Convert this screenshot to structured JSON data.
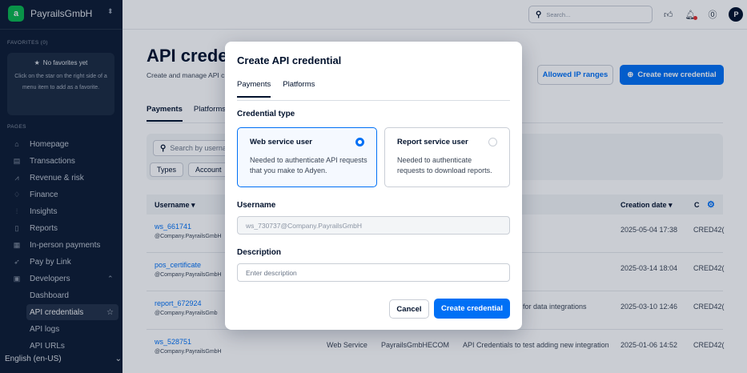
{
  "sidebar": {
    "brand": {
      "logo": "a",
      "name": "PayrailsGmbH"
    },
    "favorites_label": "FAVORITES (0)",
    "favorites": {
      "title": "No favorites yet",
      "text": "Click on the star on the right side of a menu item to add as a favorite."
    },
    "pages_label": "PAGES",
    "items": [
      {
        "label": "Homepage",
        "icon": "home-icon",
        "glyph": "⌂"
      },
      {
        "label": "Transactions",
        "icon": "transactions-icon",
        "glyph": "▤"
      },
      {
        "label": "Revenue & risk",
        "icon": "revenue-icon",
        "glyph": "⩘"
      },
      {
        "label": "Finance",
        "icon": "finance-icon",
        "glyph": "♢"
      },
      {
        "label": "Insights",
        "icon": "insights-icon",
        "glyph": "⫶"
      },
      {
        "label": "Reports",
        "icon": "reports-icon",
        "glyph": "▯"
      },
      {
        "label": "In-person payments",
        "icon": "terminal-icon",
        "glyph": "▦"
      },
      {
        "label": "Pay by Link",
        "icon": "link-icon",
        "glyph": "➶"
      },
      {
        "label": "Developers",
        "icon": "developers-icon",
        "glyph": "▣"
      }
    ],
    "sub_items": [
      "Dashboard",
      "API credentials",
      "API logs",
      "API URLs"
    ],
    "language": "English (en-US)"
  },
  "topbar": {
    "search_placeholder": "Search..."
  },
  "page": {
    "title": "API crede",
    "subtitle": "Create and manage API c",
    "allowed_ip_button": "Allowed IP ranges",
    "create_button": "Create new credential",
    "tabs": [
      "Payments",
      "Platforms"
    ],
    "search_placeholder": "Search by userna",
    "chips": [
      "Types",
      "Account"
    ],
    "columns": {
      "username": "Username",
      "creation_date": "Creation date",
      "id": "C"
    },
    "rows": [
      {
        "username": "ws_661741",
        "company": "@Company.PayrailsGmbH",
        "type": "",
        "account": "",
        "description": "",
        "date": "2025-05-04 17:38",
        "id": "CRED42("
      },
      {
        "username": "pos_certificate",
        "company": "@Company.PayrailsGmbH",
        "type": "",
        "account": "",
        "description": "",
        "date": "2025-03-14 18:04",
        "id": "CRED42("
      },
      {
        "username": "report_672924",
        "company": "@Company.PayrailsGmb",
        "type": "",
        "account": "",
        "description": "t for data integrations",
        "date": "2025-03-10 12:46",
        "id": "CRED42("
      },
      {
        "username": "ws_528751",
        "company": "@Company.PayrailsGmbH",
        "type": "Web Service",
        "account": "PayrailsGmbHECOM",
        "description": "API Credentials to test adding new integration",
        "date": "2025-01-06 14:52",
        "id": "CRED42("
      }
    ]
  },
  "modal": {
    "title": "Create API credential",
    "tabs": [
      "Payments",
      "Platforms"
    ],
    "credential_type_label": "Credential type",
    "options": [
      {
        "title": "Web service user",
        "description": "Needed to authenticate API requests that you make to Adyen."
      },
      {
        "title": "Report service user",
        "description": "Needed to authenticate requests to download reports."
      }
    ],
    "username_label": "Username",
    "username_value": "ws_730737@Company.PayrailsGmbH",
    "description_label": "Description",
    "description_placeholder": "Enter description",
    "cancel": "Cancel",
    "create": "Create credential"
  },
  "colors": {
    "accent": "#0070f5",
    "sidebar": "#0e1d35",
    "brand": "#0abf53"
  }
}
